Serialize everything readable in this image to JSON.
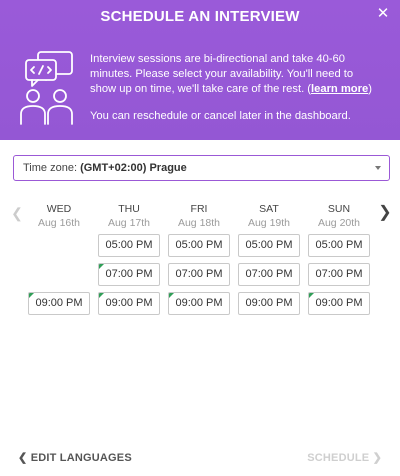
{
  "header": {
    "title": "SCHEDULE AN INTERVIEW",
    "close_icon": "close-icon",
    "illustration_icon": "interview-chat-icon",
    "intro_text": "Interview sessions are bi-directional and take 40-60 minutes. Please select your availability. You'll need to show up on time, we'll take care of the rest. (",
    "learn_more": "learn more",
    "intro_close": ")",
    "reschedule_text": "You can reschedule or cancel later in the dashboard.",
    "colors": {
      "background": "#9b59d6",
      "text": "#ffffff"
    }
  },
  "timezone": {
    "label": "Time zone:",
    "value": "(GMT+02:00) Prague",
    "caret_icon": "chevron-down-icon"
  },
  "calendar": {
    "prev_icon": "chevron-left-icon",
    "next_icon": "chevron-right-icon",
    "days": [
      {
        "name": "WED",
        "date": "Aug 16th",
        "slots": [
          {
            "time": "",
            "label": ""
          },
          {
            "time": "",
            "label": ""
          },
          {
            "time": "09:00 PM",
            "flag": true
          }
        ]
      },
      {
        "name": "THU",
        "date": "Aug 17th",
        "slots": [
          {
            "time": "05:00 PM",
            "flag": false
          },
          {
            "time": "07:00 PM",
            "flag": true
          },
          {
            "time": "09:00 PM",
            "flag": true
          }
        ]
      },
      {
        "name": "FRI",
        "date": "Aug 18th",
        "slots": [
          {
            "time": "05:00 PM",
            "flag": false
          },
          {
            "time": "07:00 PM",
            "flag": false
          },
          {
            "time": "09:00 PM",
            "flag": true
          }
        ]
      },
      {
        "name": "SAT",
        "date": "Aug 19th",
        "slots": [
          {
            "time": "05:00 PM",
            "flag": false
          },
          {
            "time": "07:00 PM",
            "flag": false
          },
          {
            "time": "09:00 PM",
            "flag": false
          }
        ]
      },
      {
        "name": "SUN",
        "date": "Aug 20th",
        "slots": [
          {
            "time": "05:00 PM",
            "flag": false
          },
          {
            "time": "07:00 PM",
            "flag": false
          },
          {
            "time": "09:00 PM",
            "flag": true
          }
        ]
      }
    ],
    "colors": {
      "flag": "#2f9e57",
      "date": "#9b9b9b"
    }
  },
  "footer": {
    "back_label": "EDIT LANGUAGES",
    "back_icon": "chevron-left-icon",
    "next_label": "SCHEDULE",
    "next_icon": "chevron-right-icon",
    "colors": {
      "next_disabled": "#cfcfcf"
    }
  }
}
